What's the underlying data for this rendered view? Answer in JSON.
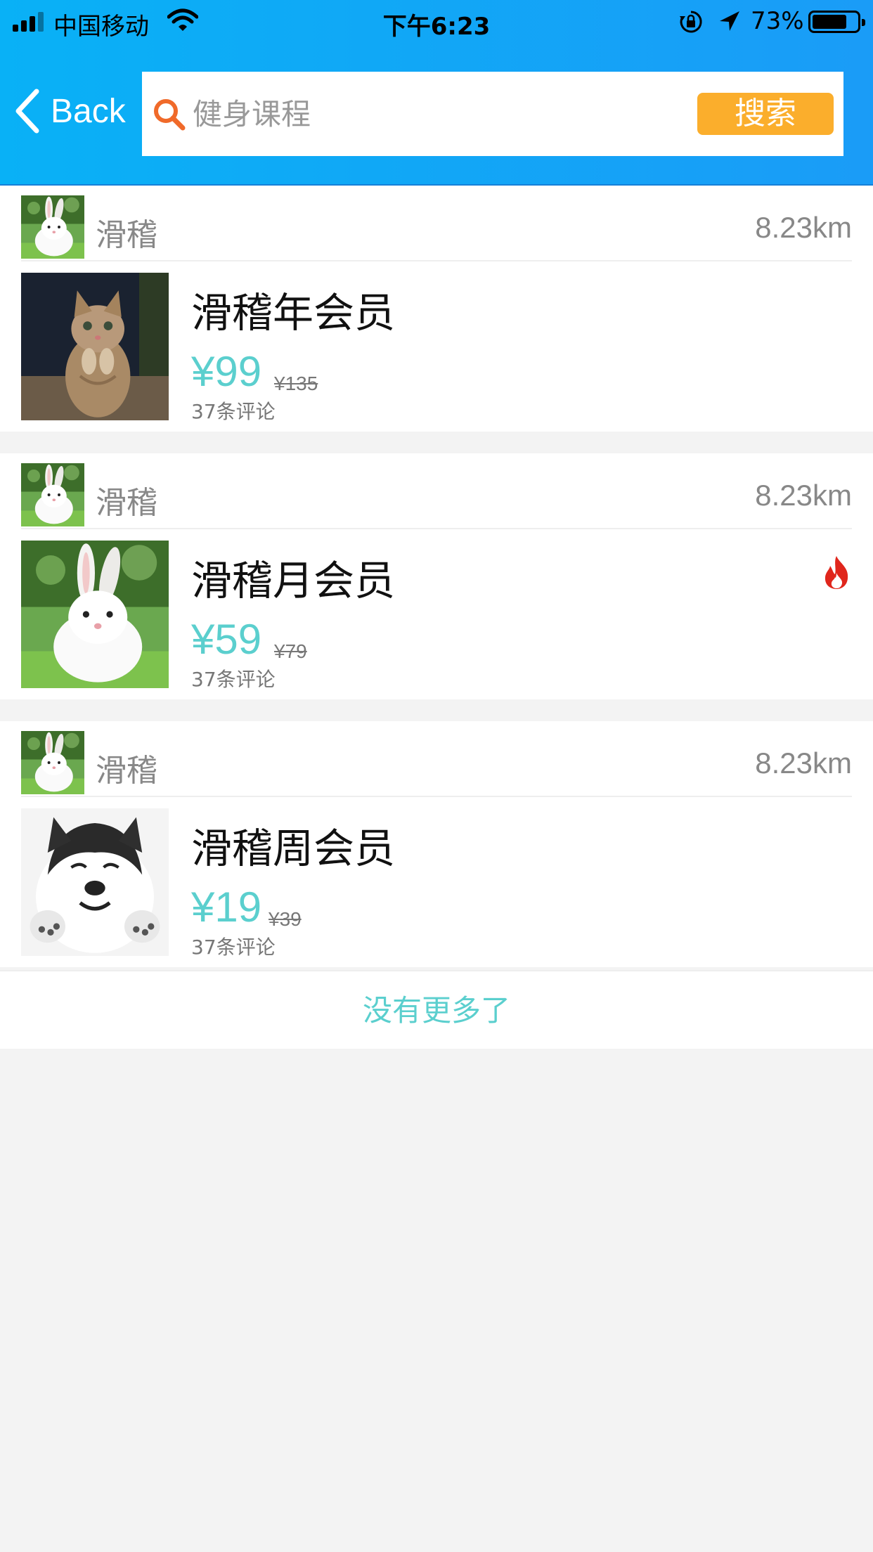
{
  "status_bar": {
    "carrier": "中国移动",
    "time": "下午6:23",
    "battery": "73%",
    "battery_level": 0.73
  },
  "header": {
    "back_label": "Back",
    "search_placeholder": "健身课程",
    "search_button": "搜索"
  },
  "colors": {
    "header_gradient": [
      "#09b1f6",
      "#1a9cf7"
    ],
    "price": "#5bcfce",
    "search_button": "#fbae2c",
    "search_icon": "#f06a2a",
    "hot_icon": "#e0261c"
  },
  "list": {
    "items": [
      {
        "shop_name": "滑稽",
        "shop_icon": "rabbit-photo",
        "distance": "8.23km",
        "product_image": "kitten-photo",
        "title": "滑稽年会员",
        "price": "¥99",
        "original_price": "¥135",
        "reviews": "37条评论",
        "hot": false
      },
      {
        "shop_name": "滑稽",
        "shop_icon": "rabbit-photo",
        "distance": "8.23km",
        "product_image": "rabbit-photo",
        "title": "滑稽月会员",
        "price": "¥59",
        "original_price": "¥79",
        "reviews": "37条评论",
        "hot": true
      },
      {
        "shop_name": "滑稽",
        "shop_icon": "rabbit-photo",
        "distance": "8.23km",
        "product_image": "husky-photo",
        "title": "滑稽周会员",
        "price": "¥19",
        "original_price": "¥39",
        "reviews": "37条评论",
        "hot": false
      }
    ],
    "end_message": "没有更多了"
  }
}
